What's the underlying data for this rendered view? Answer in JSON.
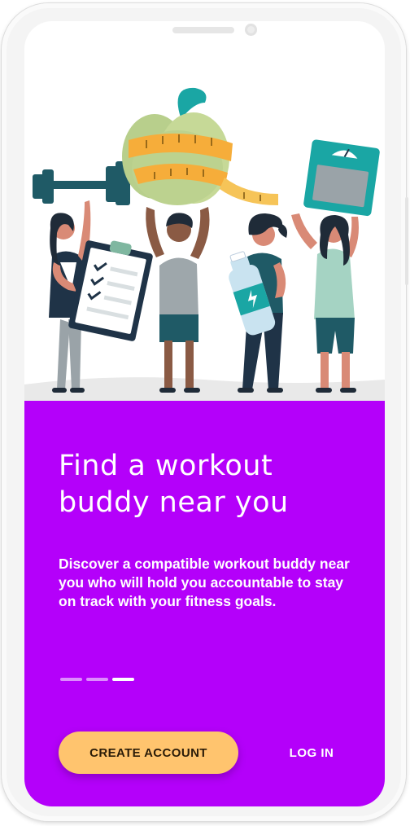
{
  "onboarding": {
    "title": "Find a workout buddy near you",
    "description": "Discover a compatible workout buddy near you who will hold you accountable to stay on track with your fitness goals.",
    "pager": {
      "total": 3,
      "current": 3
    },
    "create_account_label": "CREATE ACCOUNT",
    "login_label": "LOG IN"
  },
  "illustration": {
    "subject": "four people holding fitness items: dumbbell, clipboard checklist, apple with measuring tape, water bottle, bathroom scale",
    "icons": [
      "dumbbell-icon",
      "clipboard-icon",
      "apple-icon",
      "measuring-tape-icon",
      "water-bottle-icon",
      "scale-icon"
    ]
  },
  "colors": {
    "panel_purple": "#b400fa",
    "button_yellow": "#ffc46e",
    "teal": "#1b9c9f",
    "navy": "#1f3347",
    "white": "#ffffff"
  }
}
